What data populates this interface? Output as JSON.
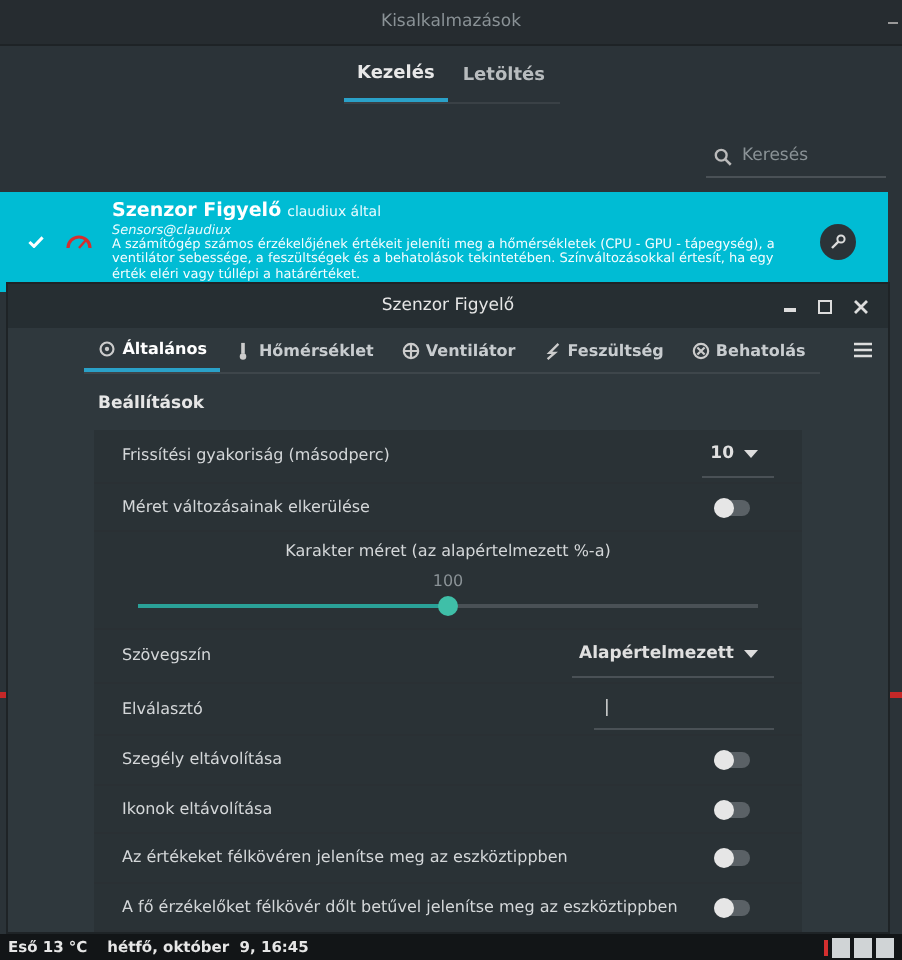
{
  "back_window": {
    "title": "Kisalkalmazások",
    "tabs": [
      {
        "label": "Kezelés",
        "selected": true
      },
      {
        "label": "Letöltés",
        "selected": false
      }
    ],
    "search": {
      "placeholder": "Keresés"
    },
    "applet": {
      "name": "Szenzor Figyelő",
      "author": "claudiux által",
      "uuid": "Sensors@claudiux",
      "description": "A számítógép számos érzékelőjének értékeit jeleníti meg a hőmérsékletek (CPU - GPU - tápegység), a ventilátor sebessége, a feszültségek és a behatolások tekintetében. Színváltozásokkal értesít, ha egy érték eléri vagy túllépi a határértéket.",
      "enabled": true
    }
  },
  "dialog": {
    "title": "Szenzor Figyelő",
    "tabs": [
      {
        "label": "Általános",
        "selected": true
      },
      {
        "label": "Hőmérséklet",
        "selected": false
      },
      {
        "label": "Ventilátor",
        "selected": false
      },
      {
        "label": "Feszültség",
        "selected": false
      },
      {
        "label": "Behatolás",
        "selected": false
      }
    ],
    "section": "Beállítások",
    "rows": [
      {
        "kind": "dropdown",
        "label": "Frissítési gyakoriság (másodperc)",
        "value": "10"
      },
      {
        "kind": "switch",
        "label": "Méret változásainak elkerülése",
        "on": false
      },
      {
        "kind": "slider",
        "label": "Karakter méret (az alapértelmezett %-a)",
        "reading": "100",
        "level": 0.5
      },
      {
        "kind": "dropdown",
        "label": "Szövegszín",
        "value": "Alapértelmezett"
      },
      {
        "kind": "text",
        "label": "Elválasztó",
        "value": "|"
      },
      {
        "kind": "switch",
        "label": "Szegély eltávolítása",
        "on": false
      },
      {
        "kind": "switch",
        "label": "Ikonok eltávolítása",
        "on": false
      },
      {
        "kind": "switch",
        "label": "Az értékeket félkövéren jelenítse meg az eszköztippben",
        "on": false
      },
      {
        "kind": "switch",
        "label": "A fő érzékelőket félkövér dőlt betűvel jelenítse meg az eszköztippben",
        "on": false
      }
    ]
  },
  "taskbar": {
    "weather": "Eső 13 °C",
    "clock": "hétfő, október  9, 16:45"
  }
}
